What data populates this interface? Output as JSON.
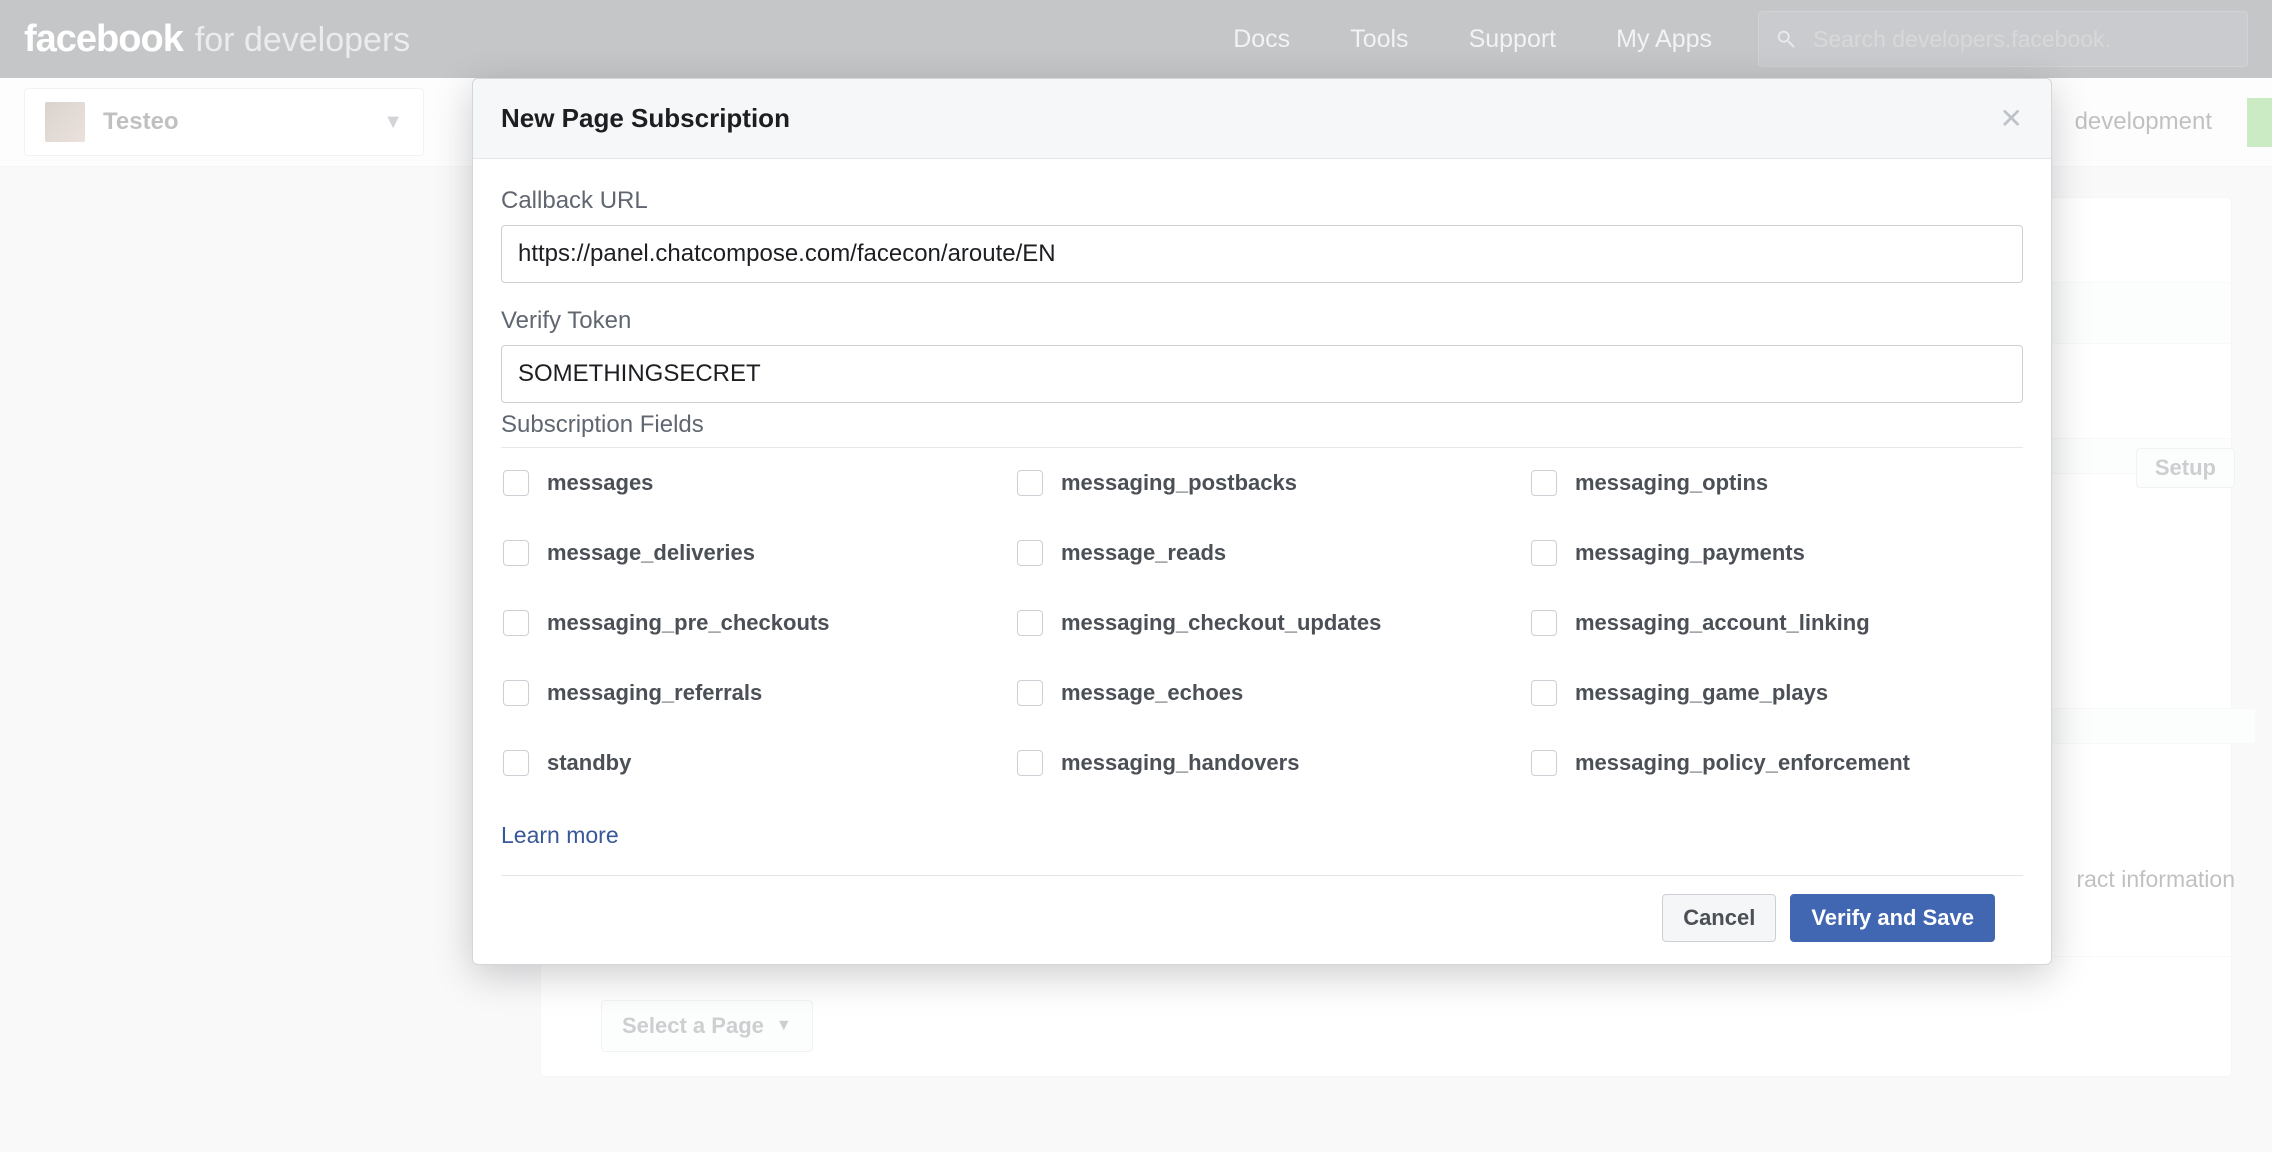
{
  "brand": {
    "fb": "facebook",
    "fd": "for developers"
  },
  "nav": {
    "docs": "Docs",
    "tools": "Tools",
    "support": "Support",
    "myapps": "My Apps"
  },
  "search": {
    "placeholder": "Search developers.facebook.com"
  },
  "appbar": {
    "appname": "Testeo",
    "status": "development",
    "setup_button": "Setup",
    "info_tail": "ract information",
    "select_page": "Select a Page"
  },
  "modal": {
    "title": "New Page Subscription",
    "callback_label": "Callback URL",
    "callback_value": "https://panel.chatcompose.com/facecon/aroute/EN",
    "verify_label": "Verify Token",
    "verify_value": "SOMETHINGSECRET",
    "subscription_label": "Subscription Fields",
    "learn_more": "Learn more",
    "cancel": "Cancel",
    "submit": "Verify and Save",
    "fields": [
      "messages",
      "messaging_postbacks",
      "messaging_optins",
      "message_deliveries",
      "message_reads",
      "messaging_payments",
      "messaging_pre_checkouts",
      "messaging_checkout_updates",
      "messaging_account_linking",
      "messaging_referrals",
      "message_echoes",
      "messaging_game_plays",
      "standby",
      "messaging_handovers",
      "messaging_policy_enforcement"
    ]
  }
}
